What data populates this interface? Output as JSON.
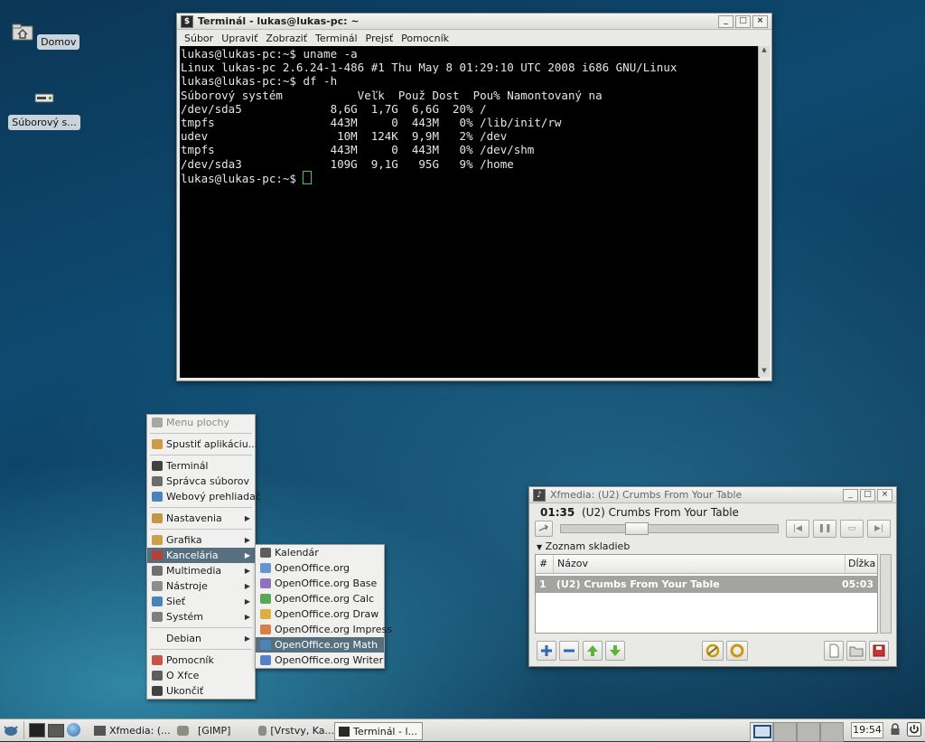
{
  "desktop": {
    "icons": [
      {
        "label": "Domov",
        "icon": "home-folder-icon"
      },
      {
        "label": "Súborový s...",
        "icon": "drive-icon"
      }
    ]
  },
  "terminal": {
    "title": "Terminál - lukas@lukas-pc: ~",
    "menu": [
      "Súbor",
      "Upraviť",
      "Zobraziť",
      "Terminál",
      "Prejsť",
      "Pomocník"
    ],
    "lines": [
      "lukas@lukas-pc:~$ uname -a",
      "Linux lukas-pc 2.6.24-1-486 #1 Thu May 8 01:29:10 UTC 2008 i686 GNU/Linux",
      "lukas@lukas-pc:~$ df -h",
      "Súborový systém           Veľk  Použ Dost  Pou% Namontovaný na",
      "/dev/sda5             8,6G  1,7G  6,6G  20% /",
      "tmpfs                 443M     0  443M   0% /lib/init/rw",
      "udev                   10M  124K  9,9M   2% /dev",
      "tmpfs                 443M     0  443M   0% /dev/shm",
      "/dev/sda3             109G  9,1G   95G   9% /home"
    ],
    "prompt": "lukas@lukas-pc:~$ "
  },
  "desktop_menu": {
    "items": [
      {
        "label": "Menu plochy",
        "icon": "desktop-menu-icon",
        "disabled": true
      },
      {
        "sep": true
      },
      {
        "label": "Spustiť aplikáciu...",
        "icon": "run-icon"
      },
      {
        "sep": true
      },
      {
        "label": "Terminál",
        "icon": "terminal-icon"
      },
      {
        "label": "Správca súborov",
        "icon": "file-manager-icon"
      },
      {
        "label": "Webový prehliadač",
        "icon": "web-browser-icon"
      },
      {
        "sep": true
      },
      {
        "label": "Nastavenia",
        "icon": "settings-icon",
        "submenu": true
      },
      {
        "sep": true
      },
      {
        "label": "Grafika",
        "icon": "graphics-icon",
        "submenu": true
      },
      {
        "label": "Kancelária",
        "icon": "office-icon",
        "submenu": true,
        "selected": true
      },
      {
        "label": "Multimedia",
        "icon": "multimedia-icon",
        "submenu": true
      },
      {
        "label": "Nástroje",
        "icon": "tools-icon",
        "submenu": true
      },
      {
        "label": "Sieť",
        "icon": "network-icon",
        "submenu": true
      },
      {
        "label": "Systém",
        "icon": "system-icon",
        "submenu": true
      },
      {
        "sep": true
      },
      {
        "label": "Debian",
        "icon": "",
        "submenu": true
      },
      {
        "sep": true
      },
      {
        "label": "Pomocník",
        "icon": "help-icon"
      },
      {
        "label": "O Xfce",
        "icon": "info-icon"
      },
      {
        "label": "Ukončiť",
        "icon": "quit-icon"
      }
    ],
    "submenu": [
      {
        "label": "Kalendár",
        "icon": "calendar-icon"
      },
      {
        "label": "OpenOffice.org",
        "icon": "openoffice-icon"
      },
      {
        "label": "OpenOffice.org Base",
        "icon": "openoffice-base-icon"
      },
      {
        "label": "OpenOffice.org Calc",
        "icon": "openoffice-calc-icon"
      },
      {
        "label": "OpenOffice.org Draw",
        "icon": "openoffice-draw-icon"
      },
      {
        "label": "OpenOffice.org Impress",
        "icon": "openoffice-impress-icon"
      },
      {
        "label": "OpenOffice.org Math",
        "icon": "openoffice-math-icon",
        "selected": true
      },
      {
        "label": "OpenOffice.org Writer",
        "icon": "openoffice-writer-icon"
      }
    ]
  },
  "xfmedia": {
    "title": "Xfmedia: (U2) Crumbs From Your Table",
    "time": "01:35",
    "track": "(U2) Crumbs From Your Table",
    "seek_fraction": 0.33,
    "playlist_toggle": "Zoznam skladieb",
    "columns": {
      "num": "#",
      "name": "Názov",
      "length": "Dĺžka"
    },
    "rows": [
      {
        "num": "1",
        "name": "(U2) Crumbs From Your Table",
        "length": "05:03"
      }
    ]
  },
  "taskbar": {
    "tasks": [
      {
        "label": "Xfmedia: (...",
        "icon": "media-player-icon"
      },
      {
        "label": "[GIMP]",
        "icon": "gimp-icon"
      },
      {
        "label": "[Vrstvy, Ka...",
        "icon": "gimp-icon"
      },
      {
        "label": "Terminál - l...",
        "icon": "terminal-icon",
        "active": true
      }
    ],
    "clock": "19:54"
  }
}
